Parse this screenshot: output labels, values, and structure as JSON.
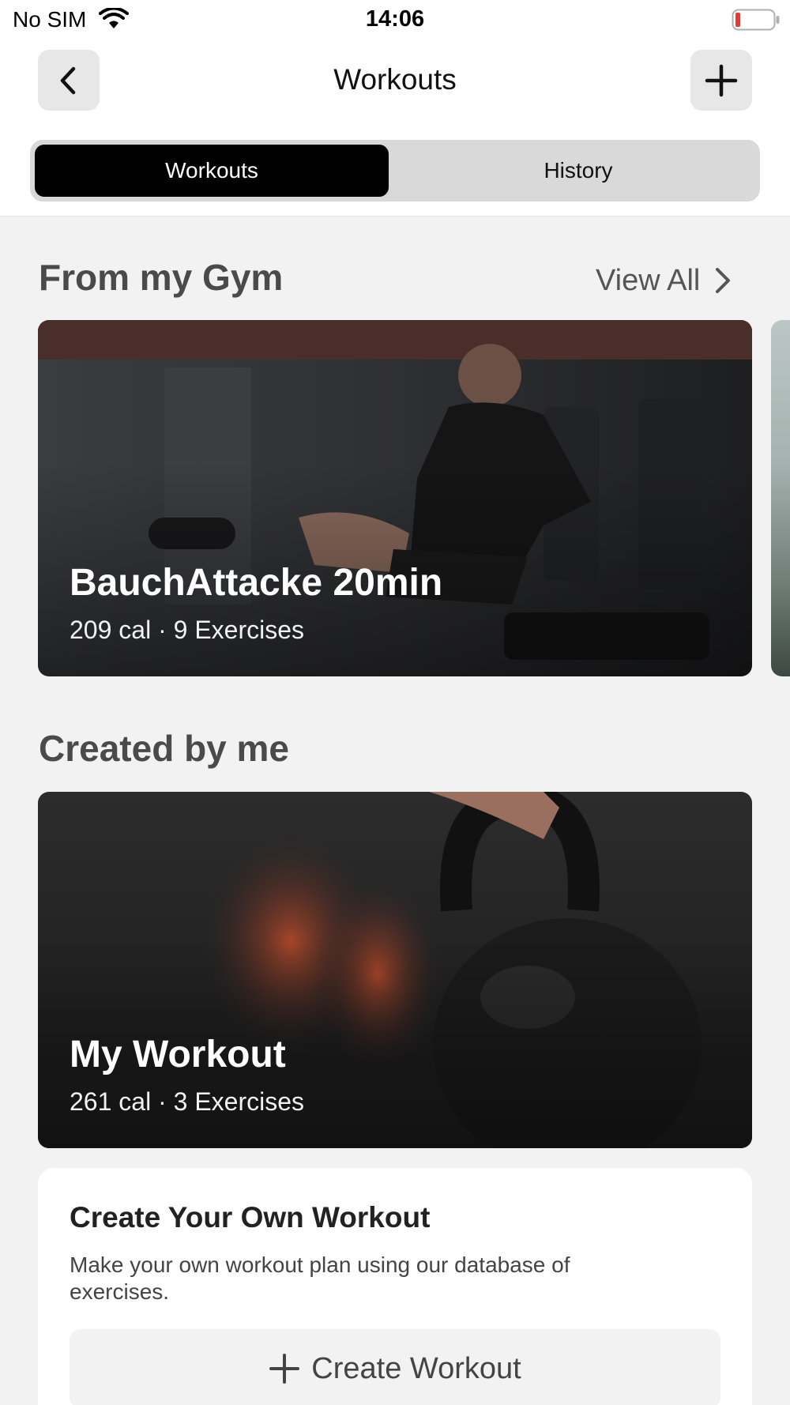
{
  "status_bar": {
    "carrier": "No SIM",
    "time": "14:06",
    "wifi_icon": "wifi-icon",
    "battery_icon": "battery-low-icon",
    "battery_color": "#e53935"
  },
  "nav": {
    "title": "Workouts",
    "back_icon": "chevron-left-icon",
    "add_icon": "plus-icon"
  },
  "segmented": {
    "tabs": [
      {
        "label": "Workouts",
        "selected": true
      },
      {
        "label": "History",
        "selected": false
      }
    ]
  },
  "gym_section": {
    "title": "From my Gym",
    "view_all": "View All",
    "card": {
      "title": "BauchAttacke 20min",
      "meta": "209 cal · 9 Exercises"
    }
  },
  "me_section": {
    "title": "Created by me",
    "card": {
      "title": "My Workout",
      "meta": "261 cal · 3 Exercises"
    }
  },
  "create_panel": {
    "heading": "Create Your Own Workout",
    "description": "Make your own workout plan using our database of exercises.",
    "button_label": "Create Workout"
  },
  "colors": {
    "accent_segment": "#000000",
    "background": "#f2f2f2"
  }
}
